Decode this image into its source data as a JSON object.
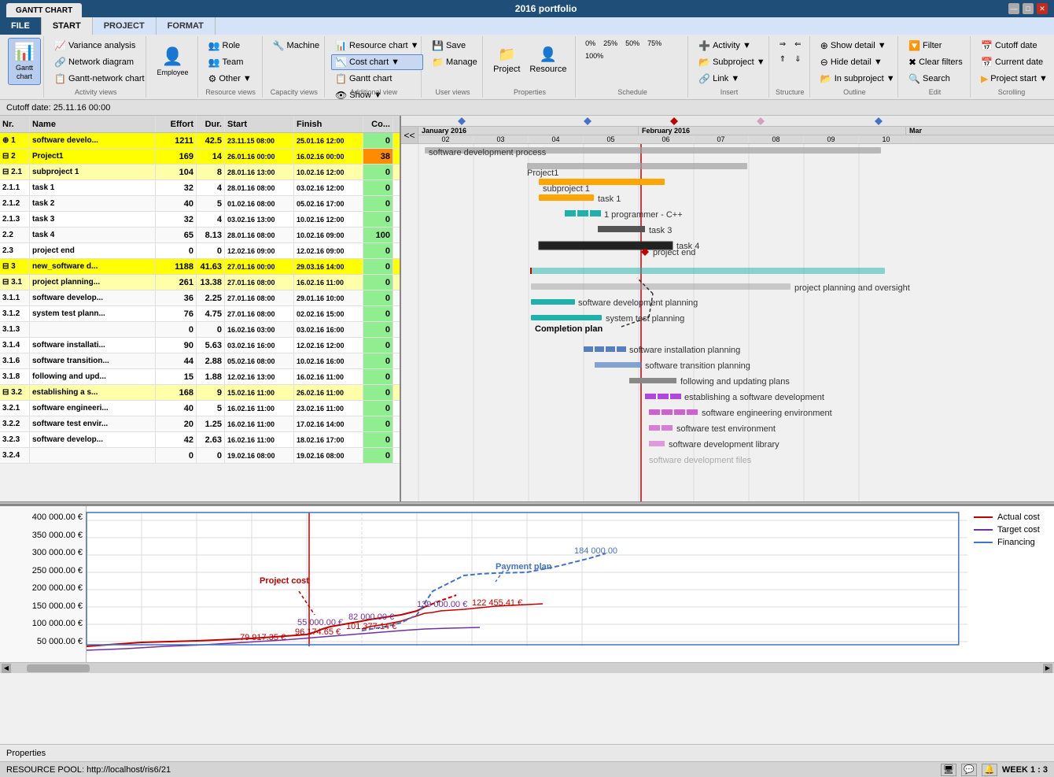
{
  "titlebar": {
    "tabs": [
      "",
      "GANTT CHART"
    ],
    "active_tab": "GANTT CHART",
    "title": "2016 portfolio",
    "controls": [
      "—",
      "□",
      "✕"
    ]
  },
  "ribbon": {
    "tabs": [
      "FILE",
      "START",
      "PROJECT",
      "FORMAT"
    ],
    "active_tab": "START",
    "groups": {
      "gantt": {
        "label": "",
        "big_btn": "Gantt\nchart"
      },
      "activity_views": {
        "label": "Activity views",
        "items": [
          "Variance analysis",
          "Network diagram",
          "Gantt-network chart"
        ]
      },
      "employee": {
        "label": "Employee",
        "big_btn": "Employee"
      },
      "resource_views": {
        "label": "Resource views",
        "items": [
          "Role",
          "Team",
          "Other ▼"
        ]
      },
      "capacity": {
        "label": "Capacity views",
        "items": [
          "Machine"
        ]
      },
      "additional": {
        "label": "Additional view",
        "items": [
          "Resource chart ▼",
          "Cost chart ▼",
          "Gantt chart",
          "Show ▼"
        ]
      },
      "user_views": {
        "label": "User views",
        "items": [
          "Save",
          "Manage"
        ]
      },
      "properties": {
        "label": "Properties",
        "items": [
          "Project",
          "Resource"
        ]
      },
      "schedule": {
        "label": "Schedule",
        "items": [
          "0%",
          "25%",
          "50%",
          "75%",
          "100%"
        ]
      },
      "insert": {
        "label": "Insert",
        "items": [
          "Activity ▼",
          "Subproject ▼",
          "Link ▼"
        ]
      },
      "structure": {
        "label": "Structure",
        "items": []
      },
      "outline": {
        "label": "Outline",
        "items": [
          "Show detail ▼",
          "Hide detail ▼",
          "In subproject ▼"
        ]
      },
      "edit": {
        "label": "Edit",
        "items": [
          "Filter",
          "Clear filters",
          "Search"
        ]
      },
      "scrolling": {
        "label": "Scrolling",
        "items": [
          "Cutoff date",
          "Current date",
          "Project start ▼"
        ]
      }
    }
  },
  "cutoff_date": "Cutoff date: 25.11.16 00:00",
  "table": {
    "headers": [
      "Nr.",
      "Name",
      "Effort",
      "Dur.",
      "Start",
      "Finish",
      "Co..."
    ],
    "rows": [
      {
        "nr": "⊕ 1",
        "name": "software develo...",
        "effort": "1211",
        "dur": "42.5",
        "start": "23.11.15 08:00",
        "finish": "25.01.16 12:00",
        "cost": "0",
        "level": "level1"
      },
      {
        "nr": "⊟ 2",
        "name": "Project1",
        "effort": "169",
        "dur": "14",
        "start": "26.01.16 00:00",
        "finish": "16.02.16 00:00",
        "cost": "38",
        "level": "level2"
      },
      {
        "nr": "  ⊟ 2.1",
        "name": "subproject 1",
        "effort": "104",
        "dur": "8",
        "start": "28.01.16 13:00",
        "finish": "10.02.16 12:00",
        "cost": "0",
        "level": "level3"
      },
      {
        "nr": "    2.1.1",
        "name": "task 1",
        "effort": "32",
        "dur": "4",
        "start": "28.01.16 08:00",
        "finish": "03.02.16 12:00",
        "cost": "0",
        "level": ""
      },
      {
        "nr": "    2.1.2",
        "name": "task 2",
        "effort": "40",
        "dur": "5",
        "start": "01.02.16 08:00",
        "finish": "05.02.16 17:00",
        "cost": "0",
        "level": ""
      },
      {
        "nr": "    2.1.3",
        "name": "task 3",
        "effort": "32",
        "dur": "4",
        "start": "03.02.16 13:00",
        "finish": "10.02.16 12:00",
        "cost": "0",
        "level": ""
      },
      {
        "nr": "  2.2",
        "name": "task 4",
        "effort": "65",
        "dur": "8.13",
        "start": "28.01.16 08:00",
        "finish": "10.02.16 09:00",
        "cost": "100",
        "level": ""
      },
      {
        "nr": "  2.3",
        "name": "project end",
        "effort": "0",
        "dur": "0",
        "start": "12.02.16 09:00",
        "finish": "12.02.16 09:00",
        "cost": "0",
        "level": ""
      },
      {
        "nr": "⊟ 3",
        "name": "new_software d...",
        "effort": "1188",
        "dur": "41.63",
        "start": "27.01.16 00:00",
        "finish": "29.03.16 14:00",
        "cost": "0",
        "level": "level1"
      },
      {
        "nr": "  ⊟ 3.1",
        "name": "project planning...",
        "effort": "261",
        "dur": "13.38",
        "start": "27.01.16 08:00",
        "finish": "16.02.16 11:00",
        "cost": "0",
        "level": "level3"
      },
      {
        "nr": "    3.1.1",
        "name": "software develop...",
        "effort": "36",
        "dur": "2.25",
        "start": "27.01.16 08:00",
        "finish": "29.01.16 10:00",
        "cost": "0",
        "level": ""
      },
      {
        "nr": "    3.1.2",
        "name": "system test plann...",
        "effort": "76",
        "dur": "4.75",
        "start": "27.01.16 08:00",
        "finish": "02.02.16 15:00",
        "cost": "0",
        "level": ""
      },
      {
        "nr": "    3.1.3",
        "name": "",
        "effort": "0",
        "dur": "0",
        "start": "16.02.16 03:00",
        "finish": "03.02.16 16:00",
        "cost": "0",
        "level": ""
      },
      {
        "nr": "    3.1.4",
        "name": "software installati...",
        "effort": "90",
        "dur": "5.63",
        "start": "03.02.16 16:00",
        "finish": "12.02.16 12:00",
        "cost": "0",
        "level": ""
      },
      {
        "nr": "    3.1.6",
        "name": "software transition...",
        "effort": "44",
        "dur": "2.88",
        "start": "05.02.16 08:00",
        "finish": "10.02.16 16:00",
        "cost": "0",
        "level": ""
      },
      {
        "nr": "    3.1.8",
        "name": "following and upd...",
        "effort": "15",
        "dur": "1.88",
        "start": "12.02.16 13:00",
        "finish": "16.02.16 11:00",
        "cost": "0",
        "level": ""
      },
      {
        "nr": "  ⊟ 3.2",
        "name": "establishing a s...",
        "effort": "168",
        "dur": "9",
        "start": "15.02.16 11:00",
        "finish": "26.02.16 11:00",
        "cost": "0",
        "level": "level3"
      },
      {
        "nr": "    3.2.1",
        "name": "software engineeri...",
        "effort": "40",
        "dur": "5",
        "start": "16.02.16 11:00",
        "finish": "23.02.16 11:00",
        "cost": "0",
        "level": ""
      },
      {
        "nr": "    3.2.2",
        "name": "software test envir...",
        "effort": "20",
        "dur": "1.25",
        "start": "16.02.16 11:00",
        "finish": "17.02.16 14:00",
        "cost": "0",
        "level": ""
      },
      {
        "nr": "    3.2.3",
        "name": "software develop...",
        "effort": "42",
        "dur": "2.63",
        "start": "16.02.16 11:00",
        "finish": "18.02.16 17:00",
        "cost": "0",
        "level": ""
      },
      {
        "nr": "    3.2.4",
        "name": "",
        "effort": "0",
        "dur": "0",
        "start": "19.02.16 08:00",
        "finish": "19.02.16 08:00",
        "cost": "0",
        "level": ""
      }
    ]
  },
  "chart": {
    "months": [
      "January 2016",
      "February 2016",
      "Mar"
    ],
    "week_labels": [
      "02",
      "03",
      "04",
      "05",
      "06",
      "07",
      "08",
      "09",
      "10"
    ],
    "labels": {
      "completion_plan": "Completion plan",
      "payment_plan": "Payment plan",
      "project_cost": "Project cost"
    }
  },
  "cost_chart": {
    "y_axis": [
      "400 000.00 €",
      "350 000.00 €",
      "300 000.00 €",
      "250 000.00 €",
      "200 000.00 €",
      "150 000.00 €",
      "100 000.00 €",
      "50 000.00 €"
    ],
    "values": {
      "v1": "79 917.35 €",
      "v2": "96 174.65 €",
      "v3": "55 000.00 €",
      "v4": "101 377.14 €",
      "v5": "82 000.00 €",
      "v6": "139 000.00 €",
      "v7": "122 455.41 €",
      "v8": "184 000.00"
    },
    "legend": {
      "actual_cost": "Actual cost",
      "target_cost": "Target cost",
      "financing": "Financing"
    }
  },
  "gantt_chart_labels": {
    "label1": "software development process",
    "label2": "Project1",
    "label3": "subproject 1",
    "label4": "task 1",
    "label5": "1 programmer - C++",
    "label6": "task 3",
    "label7": "task 4",
    "label8": "project end",
    "label9": "project planning and oversight",
    "label10": "software development planning",
    "label11": "system test planning",
    "label12": "software installation planning",
    "label13": "software transition planning",
    "label14": "following and updating plans",
    "label15": "establishing a software development",
    "label16": "software engineering environment",
    "label17": "software test environment",
    "label18": "software development library",
    "label19": "software development files"
  },
  "statusbar": {
    "resource_pool": "RESOURCE POOL: http://localhost/ris6/21",
    "properties": "Properties",
    "week": "WEEK 1 : 3"
  }
}
